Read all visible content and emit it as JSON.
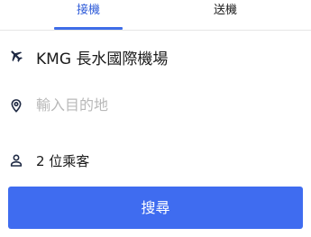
{
  "tabs": {
    "pickup_label": "接機",
    "dropoff_label": "送機",
    "active": "pickup"
  },
  "form": {
    "airport": {
      "icon": "airplane-icon",
      "value": "KMG 長水國際機場"
    },
    "destination": {
      "icon": "location-pin-icon",
      "value": "",
      "placeholder": "輸入目的地"
    },
    "passengers": {
      "icon": "person-icon",
      "label": "2 位乘客"
    }
  },
  "search_button": {
    "label": "搜尋"
  },
  "colors": {
    "accent": "#3f6cf0",
    "active_tab_text": "#2e5bd8",
    "placeholder": "#b9b9b9"
  }
}
